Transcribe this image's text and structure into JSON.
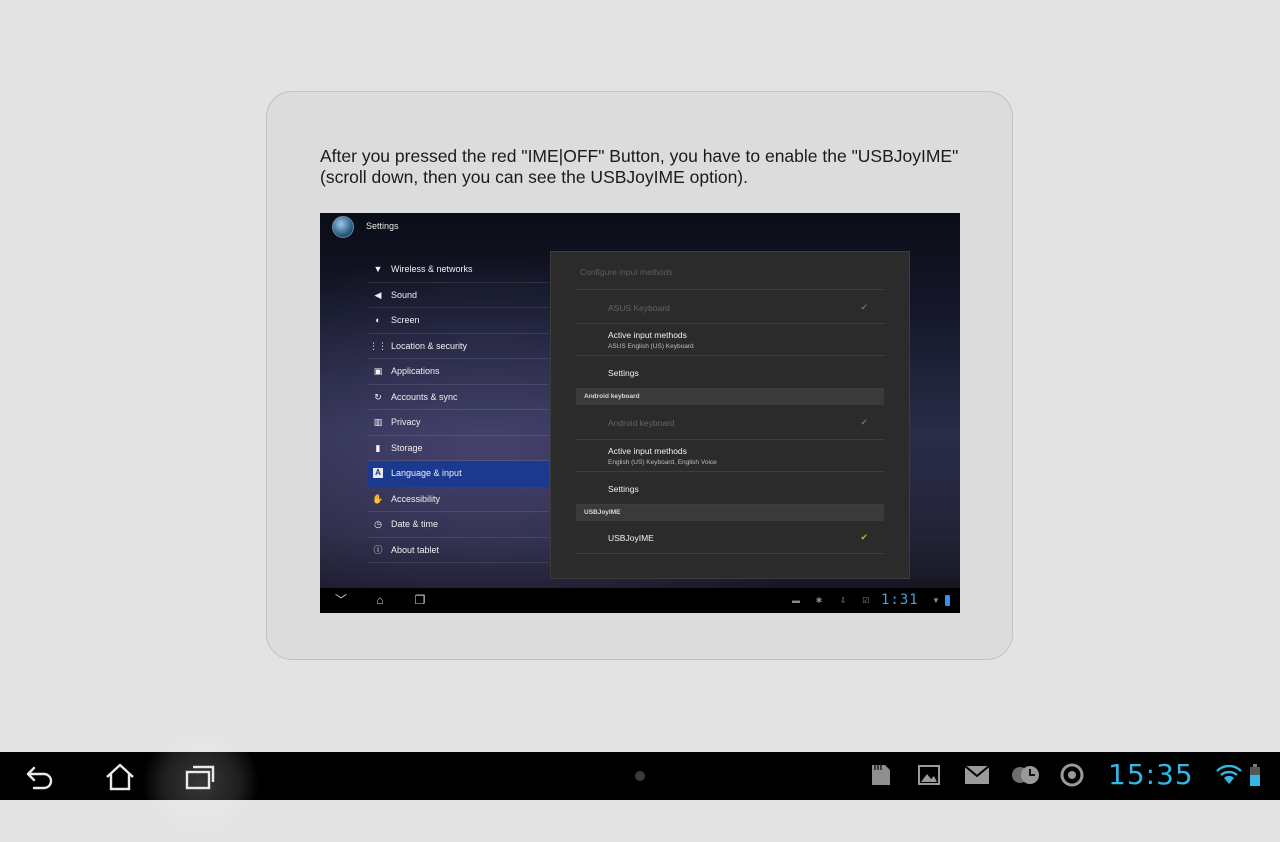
{
  "instruction": {
    "line1": "After you pressed the red \"IME|OFF\" Button, you have to enable the \"USBJoyIME\"",
    "line2": "(scroll down, then you can see the USBJoyIME option)."
  },
  "screenshot": {
    "app_title": "Settings",
    "nav_items": [
      {
        "label": "Wireless & networks",
        "icon": "wifi-icon"
      },
      {
        "label": "Sound",
        "icon": "speaker-icon"
      },
      {
        "label": "Screen",
        "icon": "brightness-icon"
      },
      {
        "label": "Location & security",
        "icon": "grid-icon"
      },
      {
        "label": "Applications",
        "icon": "applications-icon"
      },
      {
        "label": "Accounts & sync",
        "icon": "sync-icon"
      },
      {
        "label": "Privacy",
        "icon": "privacy-icon"
      },
      {
        "label": "Storage",
        "icon": "storage-icon"
      },
      {
        "label": "Language & input",
        "icon": "keyboard-a-icon",
        "active": true
      },
      {
        "label": "Accessibility",
        "icon": "hand-icon"
      },
      {
        "label": "Date & time",
        "icon": "clock-icon"
      },
      {
        "label": "About tablet",
        "icon": "info-icon"
      }
    ],
    "panel": {
      "title": "Configure input methods",
      "asus_keyboard": "ASUS Keyboard",
      "active_input_methods_1": "Active input methods",
      "active_input_methods_1_sub": "ASUS English (US) Keyboard",
      "settings_1": "Settings",
      "section_android": "Android keyboard",
      "android_keyboard": "Android keyboard",
      "active_input_methods_2": "Active input methods",
      "active_input_methods_2_sub": "English (US) Keyboard, English Voice",
      "settings_2": "Settings",
      "section_usbjoyime": "USBJoyIME",
      "usbjoyime": "USBJoyIME"
    },
    "time": "1:31"
  },
  "system_bar": {
    "clock": "15:35",
    "accent": "#33b5e5"
  }
}
